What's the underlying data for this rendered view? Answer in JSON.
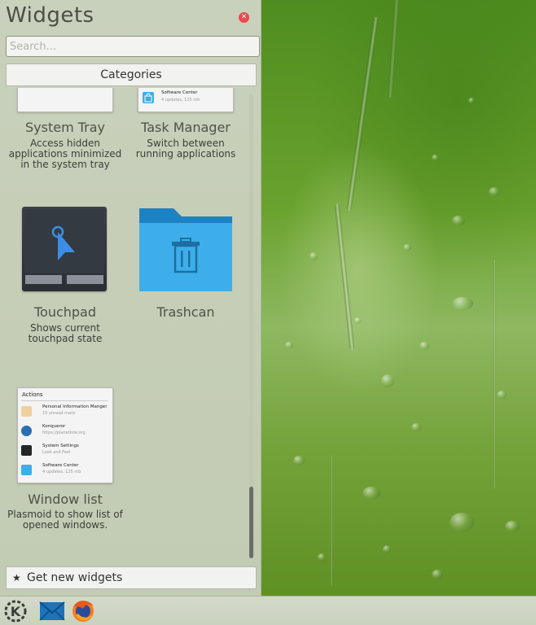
{
  "panel": {
    "title": "Widgets",
    "search_placeholder": "Search...",
    "categories_label": "Categories",
    "get_new_label": "Get new widgets",
    "close_icon": "close-icon",
    "star_icon": "star-icon"
  },
  "widgets": [
    {
      "name": "System Tray",
      "description": "Access hidden applications minimized in the system tray"
    },
    {
      "name": "Task Manager",
      "description": "Switch between running applications",
      "preview": {
        "app": "Software Center",
        "detail": "4 updates, 125 mb"
      }
    },
    {
      "name": "Touchpad",
      "description": "Shows current touchpad state"
    },
    {
      "name": "Trashcan",
      "description": ""
    },
    {
      "name": "Window list",
      "description": "Plasmoid to show list of opened windows.",
      "preview": {
        "header": "Actions",
        "rows": [
          {
            "title": "Personal Information Manger",
            "subtitle": "15 unread mails"
          },
          {
            "title": "Konqueror",
            "subtitle": "https://planetkde.org"
          },
          {
            "title": "System Settings",
            "subtitle": "Look and Feel"
          },
          {
            "title": "Software Center",
            "subtitle": "4 updates, 125 mb"
          }
        ]
      }
    }
  ],
  "scrollbar": {
    "position_fraction": 0.85
  },
  "taskbar": {
    "icons": [
      "kde-launcher-icon",
      "mail-icon",
      "firefox-icon"
    ]
  },
  "colors": {
    "close": "#e8494e",
    "touchpad_pointer": "#3a8ee6",
    "folder": "#3daee9",
    "wallpaper": "#6aa22e"
  }
}
